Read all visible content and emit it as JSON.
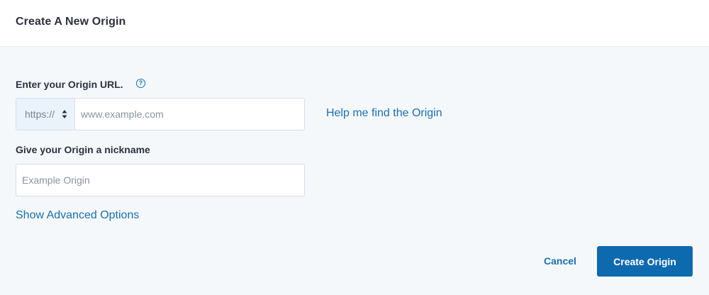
{
  "dialog": {
    "title": "Create A New Origin"
  },
  "origin_url": {
    "label": "Enter your Origin URL.",
    "help_icon": "question-circle-icon",
    "help_icon_glyph": "?",
    "protocol": {
      "selected": "https://",
      "icon": "select-arrows-icon"
    },
    "input": {
      "value": "",
      "placeholder": "www.example.com"
    },
    "help_link": "Help me find the Origin"
  },
  "nickname": {
    "label": "Give your Origin a nickname",
    "input": {
      "value": "",
      "placeholder": "Example Origin"
    }
  },
  "advanced_link": "Show Advanced Options",
  "actions": {
    "cancel_label": "Cancel",
    "create_label": "Create Origin"
  },
  "colors": {
    "accent": "#1a6fb0",
    "primary_button": "#0e6aae",
    "background": "#f5f8fb",
    "header_background": "#ffffff"
  }
}
